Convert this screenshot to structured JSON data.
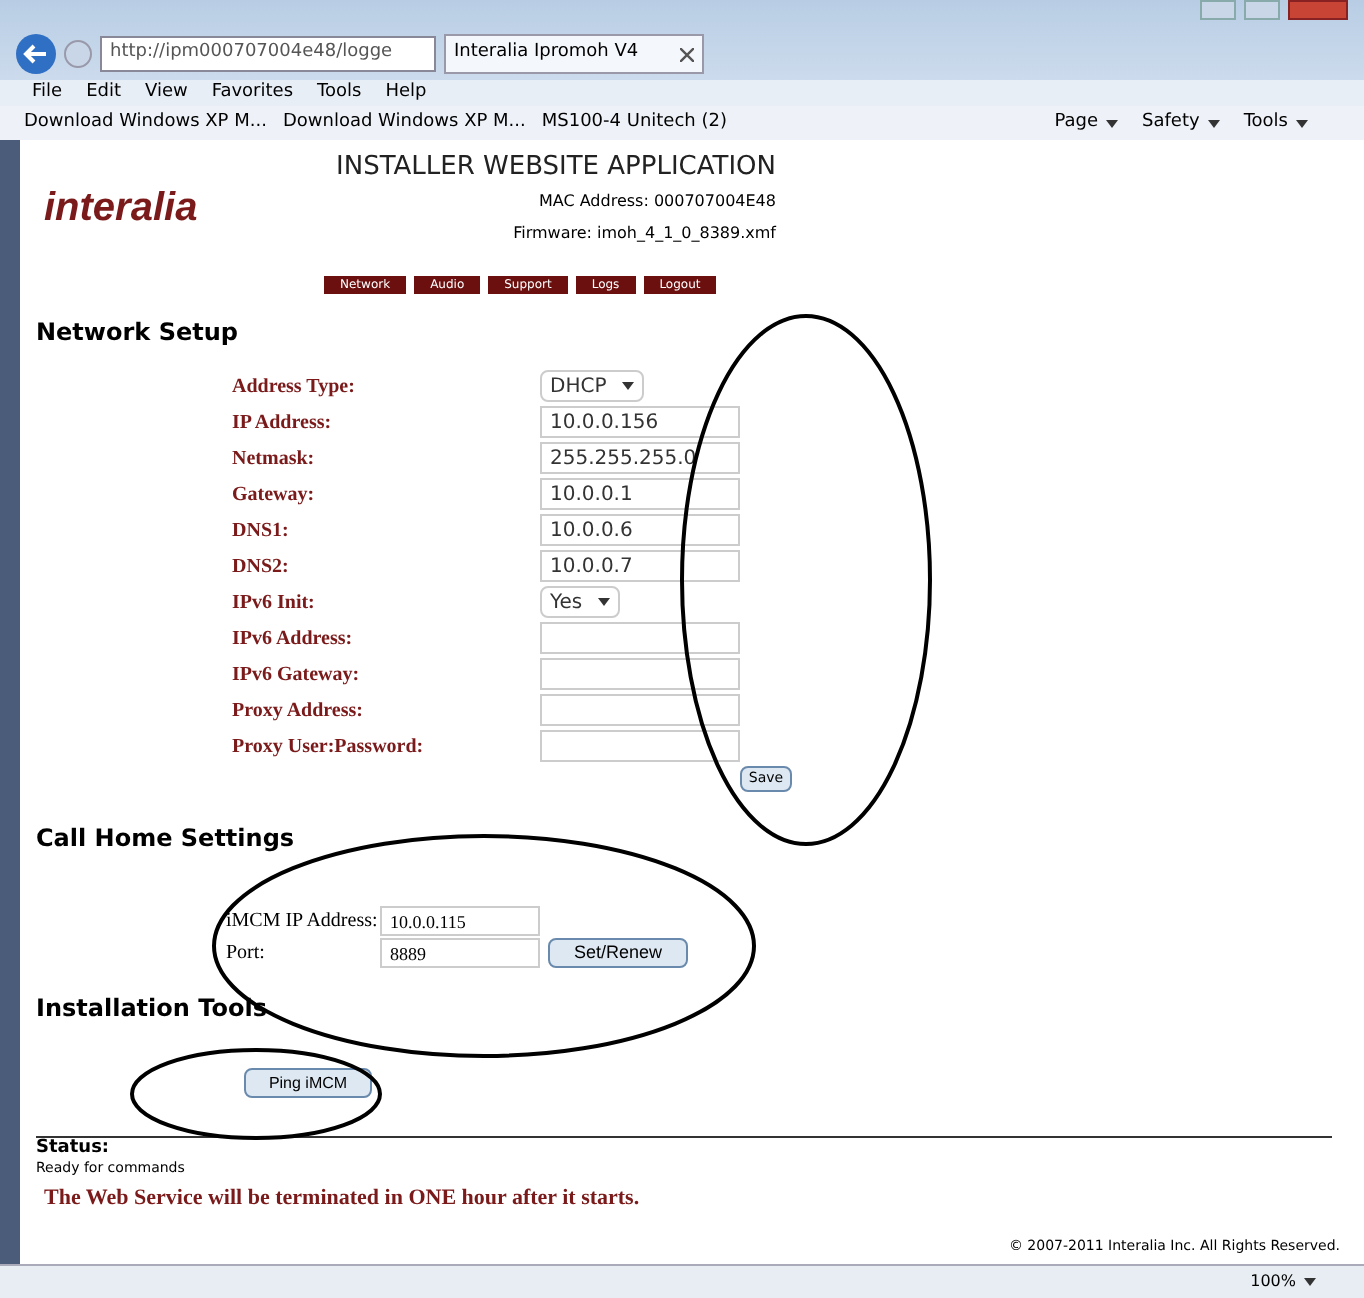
{
  "browser": {
    "address": "http://ipm000707004e48/logge",
    "tab_title": "Interalia Ipromoh V4",
    "menu": [
      "File",
      "Edit",
      "View",
      "Favorites",
      "Tools",
      "Help"
    ],
    "favorites": [
      "Download Windows XP M...",
      "Download Windows XP M...",
      "MS100-4 Unitech (2)"
    ],
    "commands": [
      "Page",
      "Safety",
      "Tools"
    ],
    "zoom": "100%"
  },
  "header": {
    "logo": "interalia",
    "title": "INSTALLER WEBSITE APPLICATION",
    "mac": "MAC Address: 000707004E48",
    "firmware": "Firmware: imoh_4_1_0_8389.xmf"
  },
  "nav": [
    "Network",
    "Audio",
    "Support",
    "Logs",
    "Logout"
  ],
  "network_setup": {
    "heading": "Network Setup",
    "fields": [
      {
        "label": "Address Type:",
        "kind": "select",
        "value": "DHCP"
      },
      {
        "label": "IP Address:",
        "kind": "input",
        "value": "10.0.0.156"
      },
      {
        "label": "Netmask:",
        "kind": "input",
        "value": "255.255.255.0"
      },
      {
        "label": "Gateway:",
        "kind": "input",
        "value": "10.0.0.1"
      },
      {
        "label": "DNS1:",
        "kind": "input",
        "value": "10.0.0.6"
      },
      {
        "label": "DNS2:",
        "kind": "input",
        "value": "10.0.0.7"
      },
      {
        "label": "IPv6 Init:",
        "kind": "select",
        "value": "Yes"
      },
      {
        "label": "IPv6 Address:",
        "kind": "input"
      },
      {
        "label": "IPv6 Gateway:",
        "kind": "input"
      },
      {
        "label": "Proxy Address:",
        "kind": "input"
      },
      {
        "label": "Proxy User:Password:",
        "kind": "input"
      }
    ],
    "save": "Save"
  },
  "call_home": {
    "heading": "Call Home Settings",
    "ip_label": "iMCM IP Address:",
    "ip_value": "10.0.0.115",
    "port_label": "Port:",
    "port_value": "8889",
    "button": "Set/Renew"
  },
  "installation_tools": {
    "heading": "Installation Tools",
    "button": "Ping iMCM"
  },
  "status": {
    "label": "Status:",
    "message": "Ready for commands",
    "warning": "The Web Service will be terminated in ONE hour after it starts."
  },
  "copyright": "© 2007-2011 Interalia Inc. All Rights Reserved."
}
